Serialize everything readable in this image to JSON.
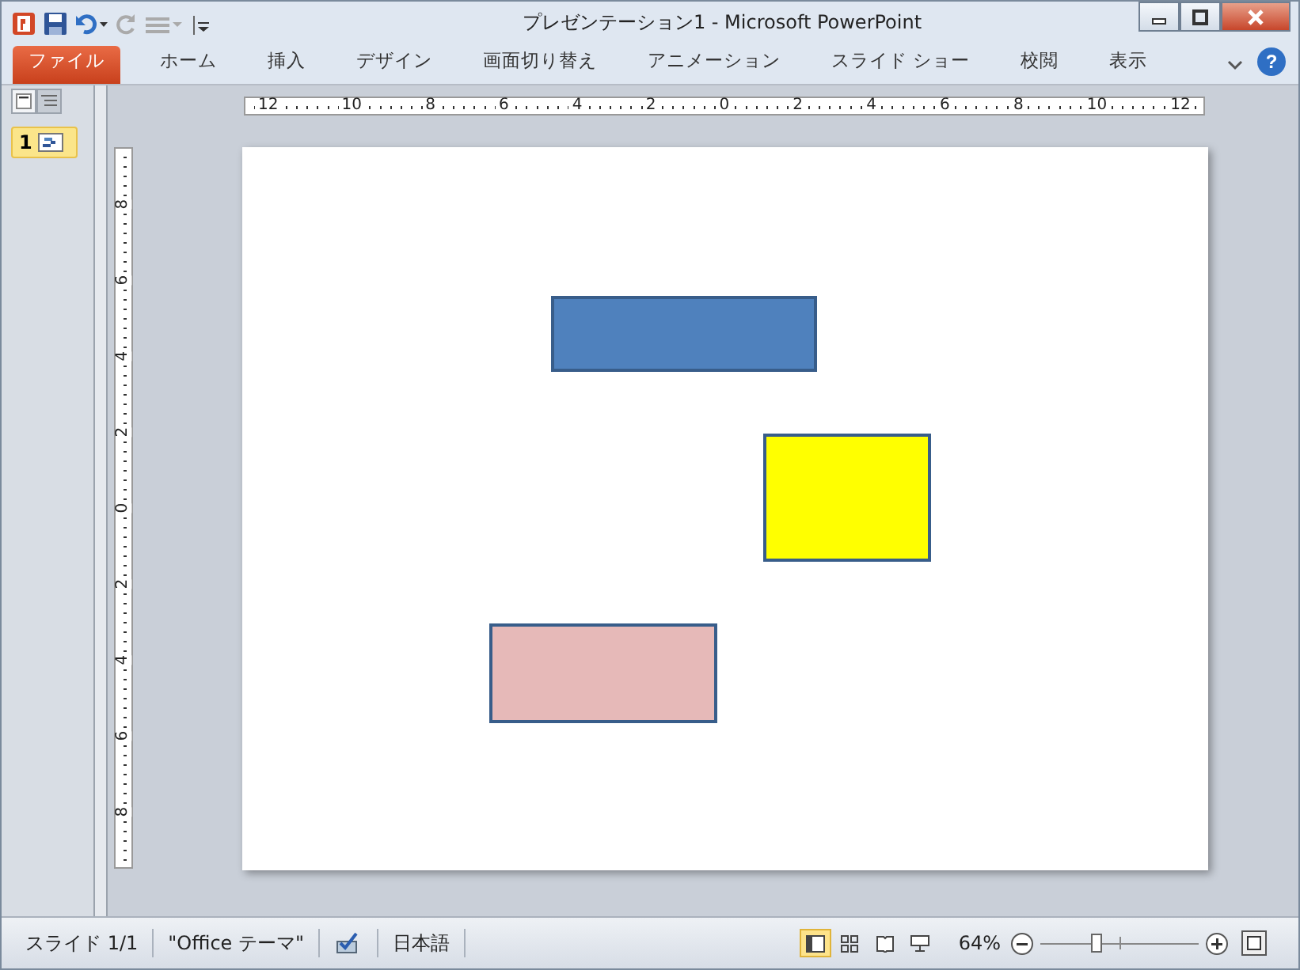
{
  "window": {
    "title": "プレゼンテーション1  -  Microsoft PowerPoint"
  },
  "tabs": [
    {
      "label": "ファイル",
      "kind": "file",
      "selected": false
    },
    {
      "label": "ホーム",
      "kind": "tab",
      "selected": false
    },
    {
      "label": "挿入",
      "kind": "tab",
      "selected": false
    },
    {
      "label": "デザイン",
      "kind": "tab",
      "selected": false
    },
    {
      "label": "画面切り替え",
      "kind": "tab",
      "selected": false
    },
    {
      "label": "アニメーション",
      "kind": "tab",
      "selected": false
    },
    {
      "label": "スライド ショー",
      "kind": "tab",
      "selected": false
    },
    {
      "label": "校閲",
      "kind": "tab",
      "selected": false
    },
    {
      "label": "表示",
      "kind": "tab",
      "selected": false
    }
  ],
  "help": "?",
  "panel_tabs": [
    {
      "kind": "slides",
      "selected": true
    },
    {
      "kind": "outline",
      "selected": false
    }
  ],
  "thumbnails": [
    {
      "number": "1",
      "selected": true
    }
  ],
  "hruler": [
    "12",
    "10",
    "8",
    "6",
    "4",
    "2",
    "0",
    "2",
    "4",
    "6",
    "8",
    "10",
    "12"
  ],
  "vruler": [
    "8",
    "6",
    "4",
    "2",
    "0",
    "2",
    "4",
    "6",
    "8"
  ],
  "shapes": [
    {
      "color": "#4f81bd"
    },
    {
      "color": "#ffff00"
    },
    {
      "color": "#e6b9b8"
    }
  ],
  "status_bar": {
    "slide": "スライド 1/1",
    "theme": "\"Office テーマ\"",
    "language": "日本語",
    "views": [
      {
        "kind": "normal",
        "selected": true
      },
      {
        "kind": "sorter",
        "selected": false
      },
      {
        "kind": "reading",
        "selected": false
      },
      {
        "kind": "show",
        "selected": false
      }
    ],
    "zoom": "64%",
    "zoom_slider": {
      "level": 0.35
    }
  }
}
